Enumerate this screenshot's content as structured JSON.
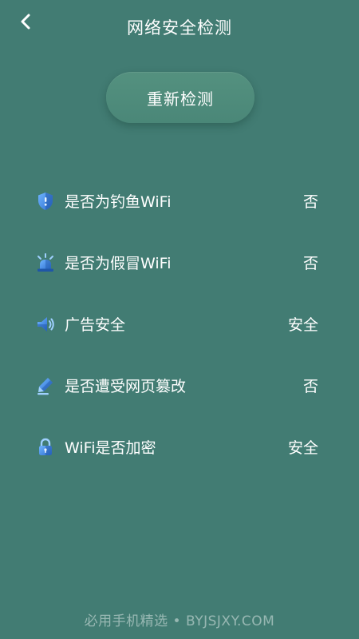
{
  "header": {
    "title": "网络安全检测",
    "back_icon": "chevron-left-icon"
  },
  "recheck_button": {
    "label": "重新检测"
  },
  "checks": [
    {
      "icon": "shield-icon",
      "label": "是否为钓鱼WiFi",
      "value": "否"
    },
    {
      "icon": "alarm-light-icon",
      "label": "是否为假冒WiFi",
      "value": "否"
    },
    {
      "icon": "speaker-icon",
      "label": "广告安全",
      "value": "安全"
    },
    {
      "icon": "pen-icon",
      "label": "是否遭受网页篡改",
      "value": "否"
    },
    {
      "icon": "lock-icon",
      "label": "WiFi是否加密",
      "value": "安全"
    }
  ],
  "footer": {
    "watermark": "必用手机精选 • BYJSJXY.COM"
  },
  "colors": {
    "background": "#427c73",
    "button": "#4f8c7b",
    "text": "#ffffff",
    "icon_blue": "#3a7fd9",
    "icon_light": "#9fd0ff"
  }
}
